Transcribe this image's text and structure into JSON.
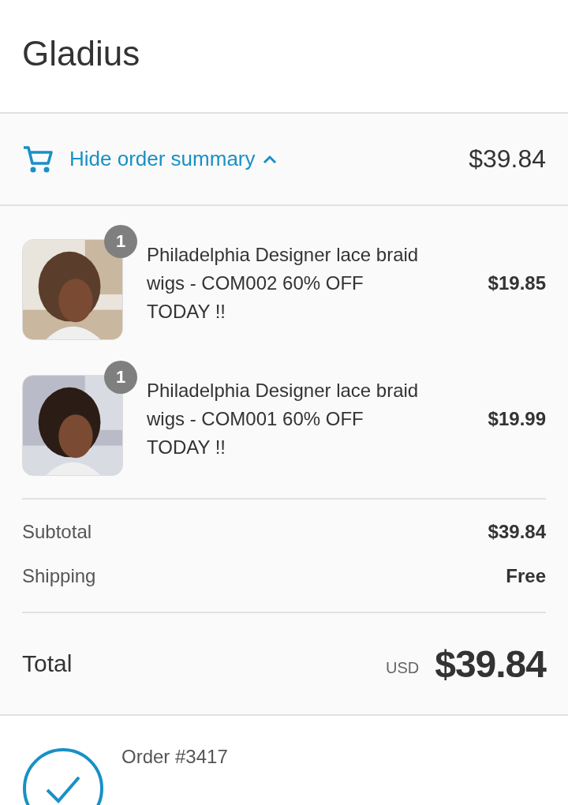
{
  "header": {
    "title": "Gladius"
  },
  "summary_toggle": {
    "label": "Hide order summary",
    "expanded": true,
    "total": "$39.84"
  },
  "items": [
    {
      "quantity": "1",
      "name": "Philadelphia Designer lace braid wigs - COM002 60% OFF TODAY !!",
      "price": "$19.85"
    },
    {
      "quantity": "1",
      "name": "Philadelphia Designer lace braid wigs - COM001 60% OFF TODAY !!",
      "price": "$19.99"
    }
  ],
  "costs": [
    {
      "label": "Subtotal",
      "value": "$39.84"
    },
    {
      "label": "Shipping",
      "value": "Free"
    }
  ],
  "total": {
    "label": "Total",
    "currency": "USD",
    "amount": "$39.84"
  },
  "order": {
    "number": "Order #3417"
  }
}
